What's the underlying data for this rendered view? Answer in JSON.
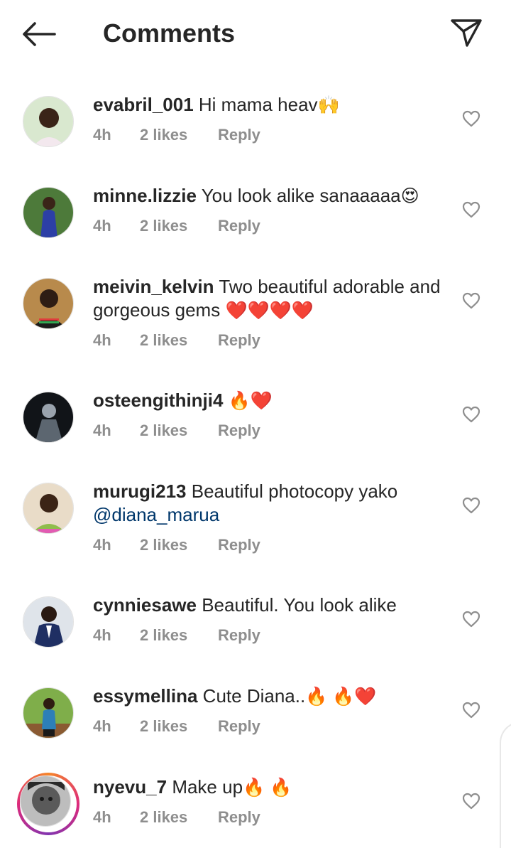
{
  "header": {
    "title": "Comments",
    "back_icon": "arrow-left-icon",
    "send_icon": "paper-plane-icon"
  },
  "comments": [
    {
      "username": "evabril_001",
      "text": "Hi mama heav",
      "emoji": "🙌",
      "time": "4h",
      "likes": "2 likes",
      "reply": "Reply"
    },
    {
      "username": "minne.lizzie",
      "text": "You look alike sanaaaaa",
      "emoji": "😍",
      "time": "4h",
      "likes": "2 likes",
      "reply": "Reply"
    },
    {
      "username": "meivin_kelvin",
      "text": "Two beautiful adorable and gorgeous gems ",
      "emoji": "❤️❤️❤️❤️",
      "time": "4h",
      "likes": "2 likes",
      "reply": "Reply"
    },
    {
      "username": "osteengithinji4",
      "text": "",
      "emoji": "🔥❤️",
      "time": "4h",
      "likes": "2 likes",
      "reply": "Reply"
    },
    {
      "username": "murugi213",
      "text": "Beautiful photocopy yako ",
      "mention": "@diana_marua",
      "time": "4h",
      "likes": "2 likes",
      "reply": "Reply"
    },
    {
      "username": "cynniesawe",
      "text": "Beautiful. You look alike",
      "time": "4h",
      "likes": "2 likes",
      "reply": "Reply"
    },
    {
      "username": "essymellina",
      "text": "Cute Diana..",
      "emoji": "🔥 🔥❤️",
      "time": "4h",
      "likes": "2 likes",
      "reply": "Reply"
    },
    {
      "username": "nyevu_7",
      "text": "Make up",
      "emoji": "🔥 🔥",
      "time": "4h",
      "likes": "2 likes",
      "reply": "Reply",
      "has_story": true
    }
  ],
  "colors": {
    "text": "#262626",
    "meta": "#8e8e8e",
    "mention": "#00376b",
    "story_ring": [
      "#f58529",
      "#dd2a7b",
      "#8134af"
    ]
  }
}
